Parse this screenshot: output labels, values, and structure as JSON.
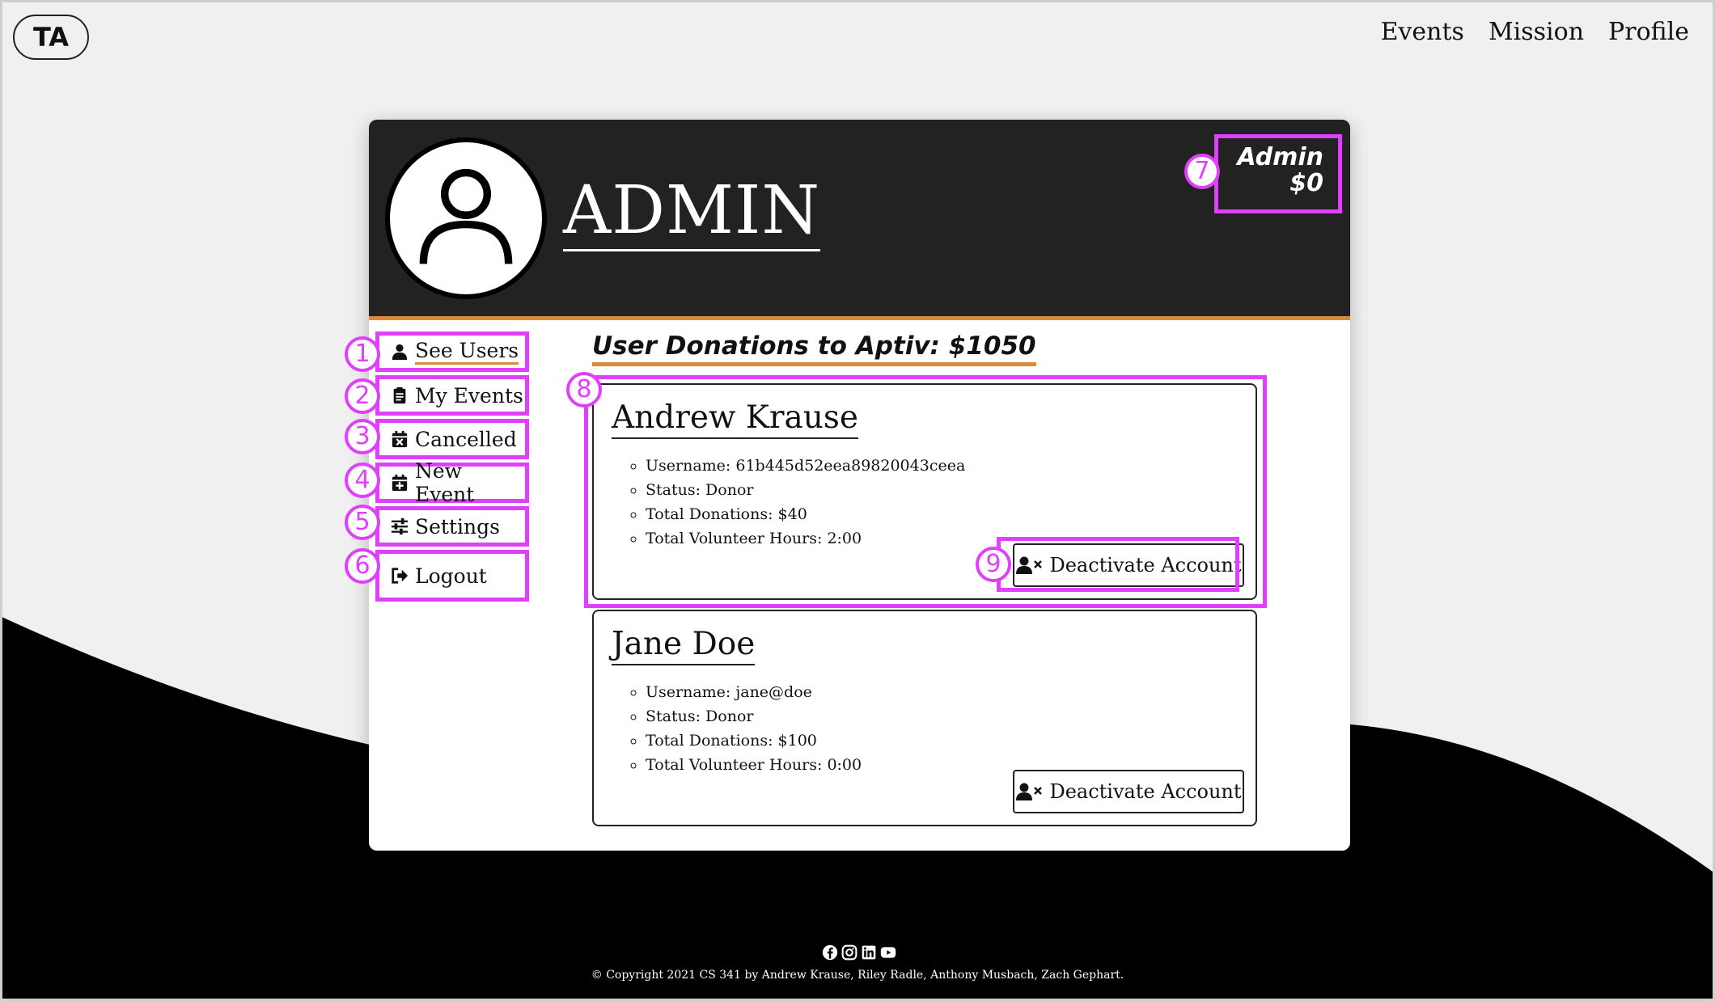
{
  "app": {
    "logo": "TA"
  },
  "nav": {
    "events": "Events",
    "mission": "Mission",
    "profile": "Profile"
  },
  "profile": {
    "name": "ADMIN",
    "role": "Admin",
    "balance": "$0"
  },
  "sidebar": {
    "items": [
      {
        "label": "See Users",
        "icon": "user-icon",
        "active": true
      },
      {
        "label": "My Events",
        "icon": "clipboard-icon"
      },
      {
        "label": "Cancelled",
        "icon": "calendar-x-icon"
      },
      {
        "label": "New Event",
        "icon": "calendar-plus-icon"
      },
      {
        "label": "Settings",
        "icon": "sliders-icon"
      },
      {
        "label": "Logout",
        "icon": "sign-out-icon"
      }
    ]
  },
  "main": {
    "donations_title": "User Donations to Aptiv: $1050",
    "users": [
      {
        "name": "Andrew Krause",
        "username": "Username: 61b445d52eea89820043ceea",
        "status": "Status: Donor",
        "donations": "Total Donations: $40",
        "hours": "Total Volunteer Hours: 2:00",
        "button": "Deactivate Account"
      },
      {
        "name": "Jane Doe",
        "username": "Username: jane@doe",
        "status": "Status: Donor",
        "donations": "Total Donations: $100",
        "hours": "Total Volunteer Hours: 0:00",
        "button": "Deactivate Account"
      }
    ]
  },
  "annotations": [
    "1",
    "2",
    "3",
    "4",
    "5",
    "6",
    "7",
    "8",
    "9"
  ],
  "footer": {
    "social_icons": [
      "facebook-icon",
      "instagram-icon",
      "linkedin-icon",
      "youtube-icon"
    ],
    "copyright": "© Copyright 2021 CS 341 by Andrew Krause, Riley Radle, Anthony Musbach, Zach Gephart."
  },
  "colors": {
    "highlight": "#e040fb",
    "accent": "#d98a3a",
    "header": "#222222"
  }
}
